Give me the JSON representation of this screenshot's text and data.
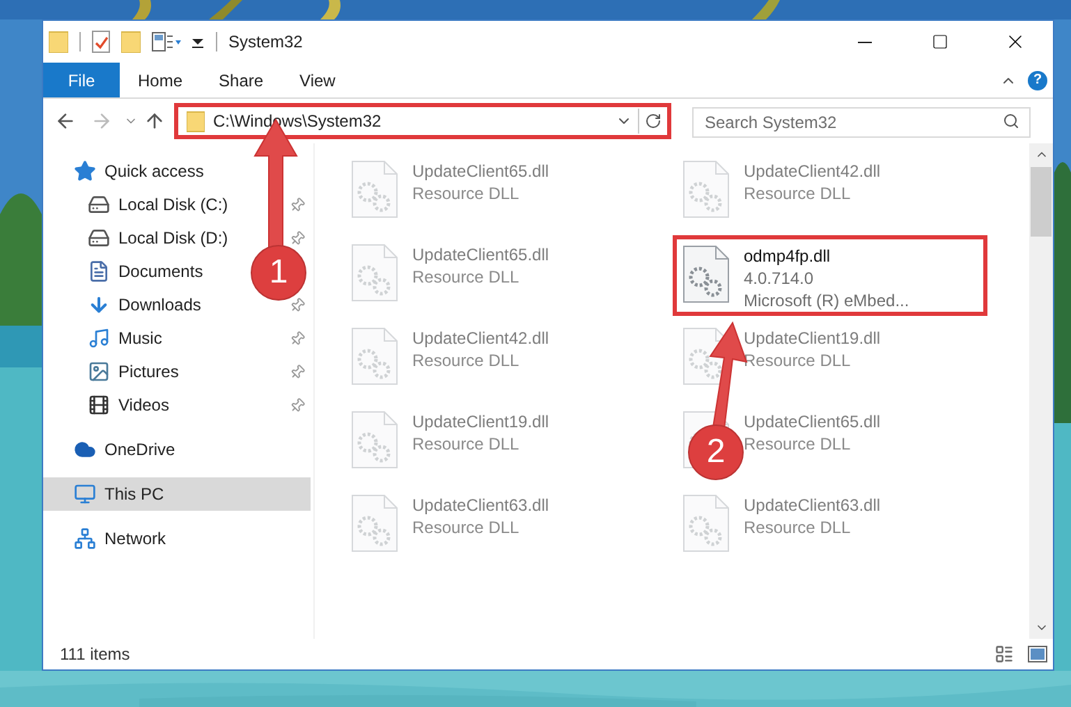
{
  "window": {
    "title": "System32"
  },
  "ribbon_tabs": [
    {
      "label": "File",
      "kind": "file"
    },
    {
      "label": "Home",
      "kind": "tab"
    },
    {
      "label": "Share",
      "kind": "tab"
    },
    {
      "label": "View",
      "kind": "tab"
    }
  ],
  "address": {
    "path": "C:\\Windows\\System32",
    "highlighted": true
  },
  "search": {
    "placeholder": "Search System32"
  },
  "sidebar": {
    "sections": [
      {
        "label": "Quick access",
        "selected": false,
        "children": [
          {
            "label": "Local Disk (C:)",
            "pinned": true
          },
          {
            "label": "Local Disk (D:)",
            "pinned": true
          },
          {
            "label": "Documents",
            "pinned": false
          },
          {
            "label": "Downloads",
            "pinned": true
          },
          {
            "label": "Music",
            "pinned": true
          },
          {
            "label": "Pictures",
            "pinned": true
          },
          {
            "label": "Videos",
            "pinned": true
          }
        ]
      },
      {
        "label": "OneDrive",
        "selected": false
      },
      {
        "label": "This PC",
        "selected": true
      },
      {
        "label": "Network",
        "selected": false
      }
    ]
  },
  "files": [
    {
      "name": "UpdateClient65.dll",
      "details": [
        "Resource DLL"
      ],
      "blurred": true,
      "highlighted": false
    },
    {
      "name": "UpdateClient42.dll",
      "details": [
        "Resource DLL"
      ],
      "blurred": true,
      "highlighted": false
    },
    {
      "name": "UpdateClient65.dll",
      "details": [
        "Resource DLL"
      ],
      "blurred": true,
      "highlighted": false
    },
    {
      "name": "odmp4fp.dll",
      "details": [
        "4.0.714.0",
        "Microsoft (R) eMbed..."
      ],
      "blurred": false,
      "highlighted": true
    },
    {
      "name": "UpdateClient42.dll",
      "details": [
        "Resource DLL"
      ],
      "blurred": true,
      "highlighted": false
    },
    {
      "name": "UpdateClient19.dll",
      "details": [
        "Resource DLL"
      ],
      "blurred": true,
      "highlighted": false
    },
    {
      "name": "UpdateClient19.dll",
      "details": [
        "Resource DLL"
      ],
      "blurred": true,
      "highlighted": false
    },
    {
      "name": "UpdateClient65.dll",
      "details": [
        "Resource DLL"
      ],
      "blurred": true,
      "highlighted": false
    },
    {
      "name": "UpdateClient63.dll",
      "details": [
        "Resource DLL"
      ],
      "blurred": true,
      "highlighted": false
    },
    {
      "name": "UpdateClient63.dll",
      "details": [
        "Resource DLL"
      ],
      "blurred": true,
      "highlighted": false
    }
  ],
  "help": {
    "label": "?"
  },
  "status_bar": {
    "item_count": "111 items"
  },
  "annotations": [
    {
      "number": "1"
    },
    {
      "number": "2"
    }
  ]
}
